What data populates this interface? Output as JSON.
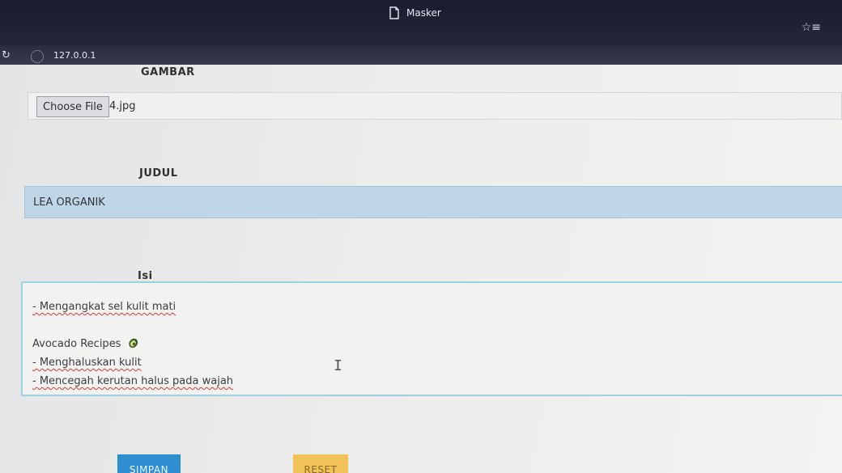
{
  "browser": {
    "tab_title": "Masker",
    "url": "127.0.0.1",
    "icons": {
      "tab": "document-icon",
      "bookmark": "bookmark-star-icon",
      "reload": "reload-icon",
      "site": "site-info-icon"
    }
  },
  "form": {
    "image_label": "GAMBAR",
    "choose_file_label": "Choose File",
    "file_name": "4.jpg",
    "title_label": "JUDUL",
    "title_value": "LEA ORGANIK",
    "content_label": "Isi",
    "content_lines": [
      "- Mengangkat sel kulit mati",
      "",
      "Avocado Recipes",
      "- Menghaluskan kulit",
      "- Mencegah kerutan halus pada wajah"
    ],
    "save_label": "SIMPAN",
    "reset_label": "RESET"
  },
  "colors": {
    "save": "#2f8fd1",
    "reset": "#f1c25a",
    "title_input_bg": "#bfd6e8",
    "textarea_border": "#9fd0e1"
  }
}
